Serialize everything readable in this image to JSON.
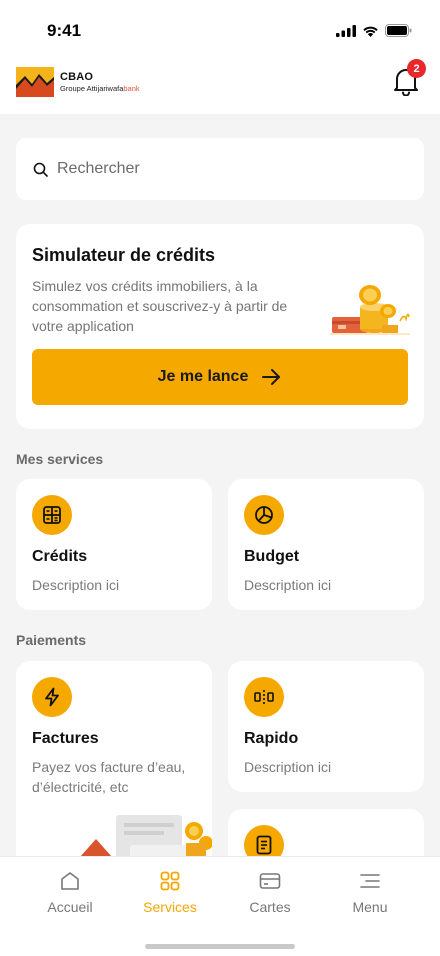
{
  "status_bar": {
    "time": "9:41"
  },
  "header": {
    "brand_name": "CBAO",
    "brand_sub": "Groupe Attijariwafa",
    "brand_sub_suffix": "bank",
    "notification_count": "2"
  },
  "search": {
    "placeholder": "Rechercher"
  },
  "simulator": {
    "title": "Simulateur de crédits",
    "description": "Simulez vos crédits immobiliers, à la consommation et souscrivez-y à partir de votre application",
    "cta_label": "Je me lance"
  },
  "mes_services": {
    "title": "Mes services",
    "items": [
      {
        "title": "Crédits",
        "description": "Description ici",
        "icon": "calculator-icon"
      },
      {
        "title": "Budget",
        "description": "Description ici",
        "icon": "pie-chart-icon"
      }
    ]
  },
  "paiements": {
    "title": "Paiements",
    "items": [
      {
        "title": "Factures",
        "description": "Payez vos facture d’eau, d’électricité, etc",
        "icon": "lightning-icon"
      },
      {
        "title": "Rapido",
        "description": "Description ici",
        "icon": "toll-icon"
      },
      {
        "title": "",
        "description": "",
        "icon": "document-icon"
      }
    ]
  },
  "bottom_nav": {
    "items": [
      {
        "label": "Accueil",
        "icon": "home-icon"
      },
      {
        "label": "Services",
        "icon": "grid-icon",
        "active": true
      },
      {
        "label": "Cartes",
        "icon": "card-icon"
      },
      {
        "label": "Menu",
        "icon": "menu-icon"
      }
    ]
  },
  "colors": {
    "accent": "#f5a800",
    "badge": "#e8282b",
    "background": "#f4f4f4"
  }
}
